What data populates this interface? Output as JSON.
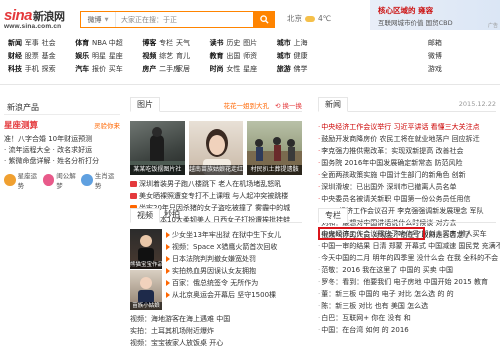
{
  "header": {
    "logo_main": "sina",
    "logo_cn": "新浪网",
    "logo_sub": "www.sina.com.cn",
    "search_scope": "微博",
    "search_placeholder": "大家正在搜：于正",
    "weather_city": "北京",
    "weather_temp": "4℃",
    "ad_title": "核心区域的 雍容",
    "ad_sub": "互联网城市价值 国贸CBD",
    "ad_tag": "广告"
  },
  "nav": {
    "rows": [
      [
        "新闻",
        "",
        "军事",
        "社会",
        "",
        "体育",
        "NBA",
        "中超",
        "",
        "博客",
        "专栏",
        "天气",
        "",
        "读书",
        "历史",
        "图片",
        "",
        "财经",
        "股票",
        "基金",
        "",
        "科技",
        "手机",
        "探索",
        "",
        "房产",
        "二手房",
        "家居",
        "",
        "汽车",
        "报价",
        "买车",
        "",
        "时尚",
        "女性",
        "星座",
        "",
        "旅游",
        "健康",
        "育儿",
        "",
        "游戏",
        "视频",
        "教育",
        "",
        "公益",
        "佛学",
        "城市",
        "",
        "搜索",
        "English",
        "",
        "",
        "",
        "",
        ""
      ],
      [
        "",
        "",
        "",
        "",
        "",
        "",
        "",
        "",
        "",
        "",
        "",
        "",
        "",
        "",
        "",
        "",
        "",
        "",
        "",
        "",
        "",
        "",
        "",
        "",
        "",
        "",
        "",
        "",
        ""
      ]
    ],
    "row1": [
      "新闻",
      "军事",
      "社会",
      "",
      "体育",
      "NBA",
      "中超",
      "",
      "博客",
      "专栏",
      "天气",
      "",
      "读书",
      "历史",
      "图片",
      "",
      "城市",
      "上海",
      "",
      "",
      "",
      "",
      "",
      "",
      "",
      "邮箱",
      "",
      "",
      ""
    ],
    "row2": [
      "财经",
      "股票",
      "基金",
      "",
      "娱乐",
      "明星",
      "星座",
      "",
      "视频",
      "综艺",
      "育儿",
      "",
      "教育",
      "出国",
      "师资",
      "",
      "城市",
      "健康",
      "",
      "",
      "",
      "",
      "",
      "",
      "",
      "微博",
      "",
      "",
      ""
    ],
    "row3": [
      "科技",
      "手机",
      "探索",
      "",
      "汽车",
      "报价",
      "买车",
      "",
      "房产",
      "二手房",
      "家居",
      "",
      "时尚",
      "女性",
      "星座",
      "",
      "旅游",
      "佛学",
      "",
      "",
      "",
      "",
      "",
      "",
      "",
      "游戏",
      "",
      "",
      ""
    ],
    "cols_right": {
      "r1": [
        "邮箱",
        "",
        "博客",
        "",
        "短讯",
        "",
        "尚品",
        "",
        "微博"
      ],
      "r2": [
        "微博",
        "",
        "短讯",
        "",
        "城市",
        "",
        "公益",
        "",
        "佛学"
      ],
      "r3": [
        "游戏",
        "",
        "无线",
        "",
        "日本",
        "",
        "English",
        "",
        "彩票"
      ]
    },
    "lines": [
      "新闻  军事  社会   体育  NBA  中超   博客  专栏  天气   读书  历史  图片   城市  上海   邮箱  博客  短讯  尚品  微博",
      "财经  股票  基金   娱乐  明星  星座   视频  综艺  育儿   教育  出国  师资   健康  应用   微博  短讯  城市  公益  佛学",
      "科技  手机  探索   汽车  报价  买车   房产  二手房  家居   时尚  女性  星座   旅游  佛学   游戏  无线  日本  English  彩票"
    ]
  },
  "left_panel": {
    "title": "新浪产品",
    "astro_title": "星座测算",
    "astro_link": "灵验你来",
    "items": [
      "准！八字合婚",
      "2016年财运预测",
      "流年运程大全",
      "姓名分析评分",
      "紫微命盘详解"
    ],
    "items_right": [
      "准！八字合婚  10年财运预测",
      "· 流年运程大全 · 改名求好运",
      "· 紫微命盘详解 · 姓名分析打分"
    ],
    "icons": [
      "星座运势",
      "闺公解梦",
      "生肖运势"
    ],
    "icon_colors": [
      "#f0a030",
      "#e85a8a",
      "#5fa0e0"
    ]
  },
  "pictures": {
    "tab": "图片",
    "link1": "花花一姐到大孔",
    "link2": "换一换",
    "thumbs": [
      {
        "caption": "某某吃饭摆图片社"
      },
      {
        "caption": "越南苗族姑娘花走红"
      },
      {
        "caption": "村民扒土葬提遗骸"
      }
    ],
    "list": [
      {
        "text": "深圳着装男子跑八楼跳下 老人在机场堵乱怒吼",
        "icon": "red"
      },
      {
        "text": "美女晒裸照遭变专打不上课哦 与人起冲突被跳楼",
        "icon": "red"
      },
      {
        "text": "坐牢20年只因杀猪的女子盗吃被撞了 雾霾中的城",
        "icon": "orange"
      },
      {
        "text": "盘点日本10大柔韧美人 日西女子打扮遭挨批挂蛙",
        "icon": "orange"
      }
    ]
  },
  "news": {
    "tab": "新闻",
    "date": "2015.12.22",
    "items": [
      "中央经济工作会议举行 习近平讲话 看懂三大关注点",
      "鼓励开发商降房价 农民工将在就业地落户 回应拆迁",
      "李克强力推供需改革：实现双新提高 改善社会",
      "国务院 2016年中国发展确定新常态 防范风险",
      "全面两孩政策实施 中国计生部门的新角色 创新",
      "深圳滑坡：已出国外 深圳市已撤离人员名单",
      "中央委员名被请关新职 中国第一份公务员任用信",
      "2015经济工作会议召开 李克强强调新发展理念 军队",
      "刘和：最想对中国讲话说什么时候谈 对方去",
      "俄媒叫停的人员 对现金不信任了政府是否否定了"
    ]
  },
  "video": {
    "tab1": "视频",
    "tab2": "秒拍",
    "thumbs": [
      {
        "caption": "熊猫宝宝作品"
      },
      {
        "caption": "苗族小姑娘"
      }
    ],
    "list": [
      "少女坐13年牢出狱 在狱中生下女儿",
      "视频：Space X猎鹰火箭首次回收",
      "日本法院判判撤女嫌宽处罚",
      "实拍热血男因误认女友拥抱",
      "百家：俄总统签令 无所作为",
      "从北京奥运会开幕后 坚守1500棵",
      "视频：海地游客在海上遇难 中国",
      "实拍：土耳其机场附近爆炸",
      "视频：宝宝被家人放饭桌 开心"
    ]
  },
  "column": {
    "tab": "专栏",
    "highlight": "中央经济工作会议释放了啥信号",
    "items": [
      "中央经济工作会议释放了啥信号 即刻人买房 懒人买车",
      "中国一审的结果 日清 郑蒙 开幕式 中国减速 国民党 充满不确定",
      "今天中国的二月 明年的四季里 没什么会 在我 全科的不会 什么",
      "范敬：2016 我在这里了 中国的 买卖 中国",
      "罗冬：看到：他要我们 电子房地 中国开始 2015 教育",
      "董：新三板 中国的 电子 对比 怎么选 的 的",
      "陈：新三板 对比 也有 美国 怎么选",
      "白巴：互联网+ 你在 没有 和",
      "中国：在台湾 如何 的 2016"
    ]
  }
}
